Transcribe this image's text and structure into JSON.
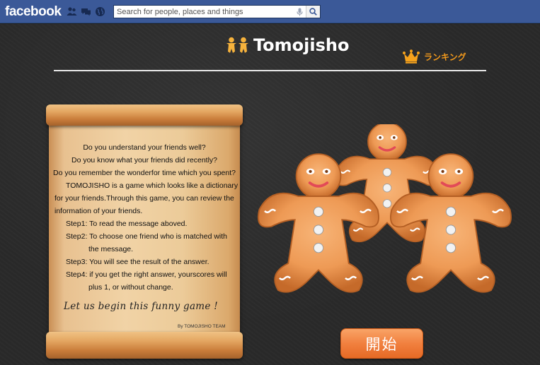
{
  "fb": {
    "logo": "facebook",
    "search_placeholder": "Search for people, places and things"
  },
  "app": {
    "title": "Tomojisho",
    "ranking_label": "ランキング",
    "start_label": "開始"
  },
  "scroll": {
    "q1": "Do you understand your friends well?",
    "q2": "Do you know what your friends did recently?",
    "q3": "Do you remember the wonderfor time which you spent?",
    "p1": "TOMOJISHO is a game which looks like a dictionary",
    "p2": "for your friends.Through this game, you can review the",
    "p3": "information of your friends.",
    "s1": "Step1: To read the message aboved.",
    "s2a": "Step2: To choose one friend who is matched with",
    "s2b": "the message.",
    "s3": "Step3: You will see the result of the answer.",
    "s4a": "Step4: if you get the right answer, yourscores will",
    "s4b": "plus 1, or without change.",
    "closing": "Let us begin this funny game !",
    "signature": "By TOMOJISHO TEAM"
  },
  "colors": {
    "fb_blue": "#3b5998",
    "accent_orange": "#f39a1c",
    "button_orange": "#f1803f"
  },
  "icons": [
    "friend-requests-icon",
    "messages-icon",
    "notifications-globe-icon",
    "microphone-icon",
    "search-icon",
    "crown-icon",
    "app-logo-icon",
    "gingerbread-cookies-image"
  ]
}
